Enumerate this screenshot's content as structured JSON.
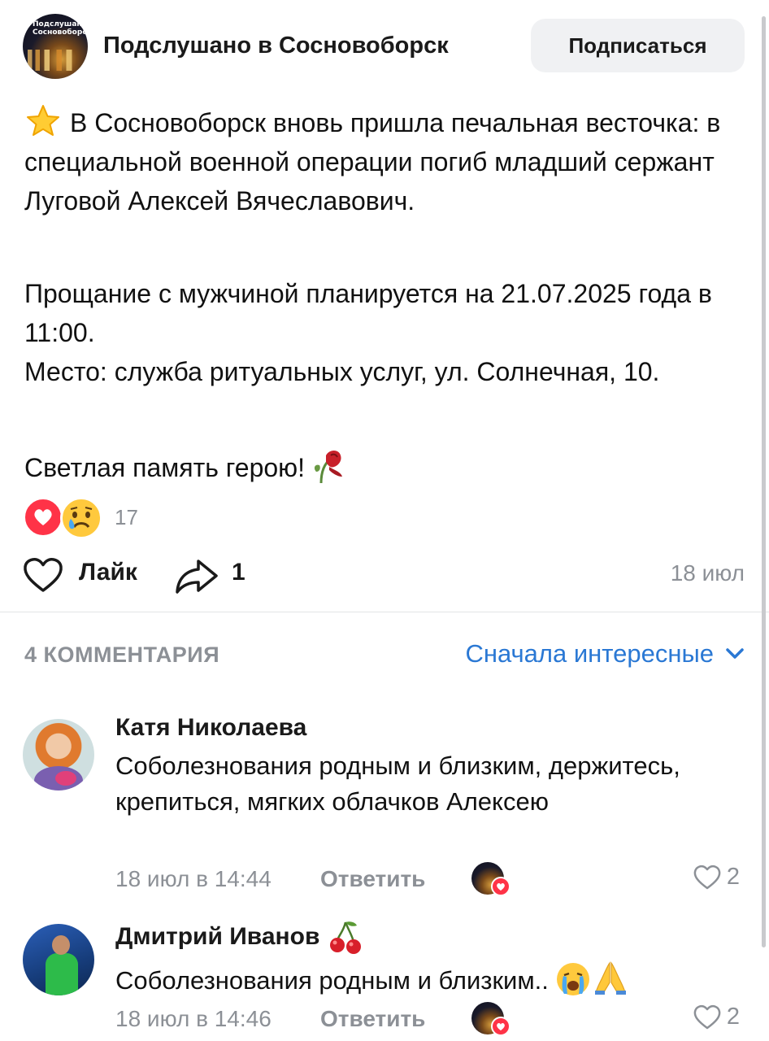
{
  "group": {
    "avatar_text": "Подслушано Сосновоборск",
    "name": "Подслушано в Сосновоборск",
    "subscribe_label": "Подписаться"
  },
  "post": {
    "paragraph1": "В Сосновоборск вновь пришла печальная весточка: в специальной военной операции погиб младший сержант Луговой Алексей Вячеславович.",
    "paragraph2_line1": "Прощание с мужчиной планируется на 21.07.2025 года в 11:00.",
    "paragraph2_line2": "Место: служба ритуальных услуг, ул. Солнечная, 10.",
    "paragraph3": "Светлая память герою!",
    "reactions_count": "17",
    "like_label": "Лайк",
    "share_count": "1",
    "date": "18 июл"
  },
  "comments_section": {
    "title": "4 КОММЕНТАРИЯ",
    "sort_label": "Сначала интересные"
  },
  "comments": [
    {
      "author": "Катя Николаева",
      "text": "Соболезнования родным и близким, держитесь, крепиться, мягких облачков Алексею",
      "time": "18 июл в 14:44",
      "reply_label": "Ответить",
      "likes": "2"
    },
    {
      "author": "Дмитрий Иванов",
      "text": "Соболезнования родным и близким..",
      "time": "18 июл в 14:46",
      "reply_label": "Ответить",
      "likes": "2"
    }
  ],
  "colors": {
    "accent_link": "#2a78d4",
    "secondary_text": "#8c9096",
    "heart_red": "#ff3347",
    "button_bg": "#f0f1f3"
  },
  "icons": [
    "star-emoji-icon",
    "wilted-rose-icon",
    "heart-reaction-icon",
    "crying-face-reaction-icon",
    "like-heart-icon",
    "share-arrow-icon",
    "chevron-down-icon",
    "cherries-emoji-icon",
    "sob-emoji-icon",
    "praying-hands-icon",
    "comment-like-heart-icon"
  ]
}
